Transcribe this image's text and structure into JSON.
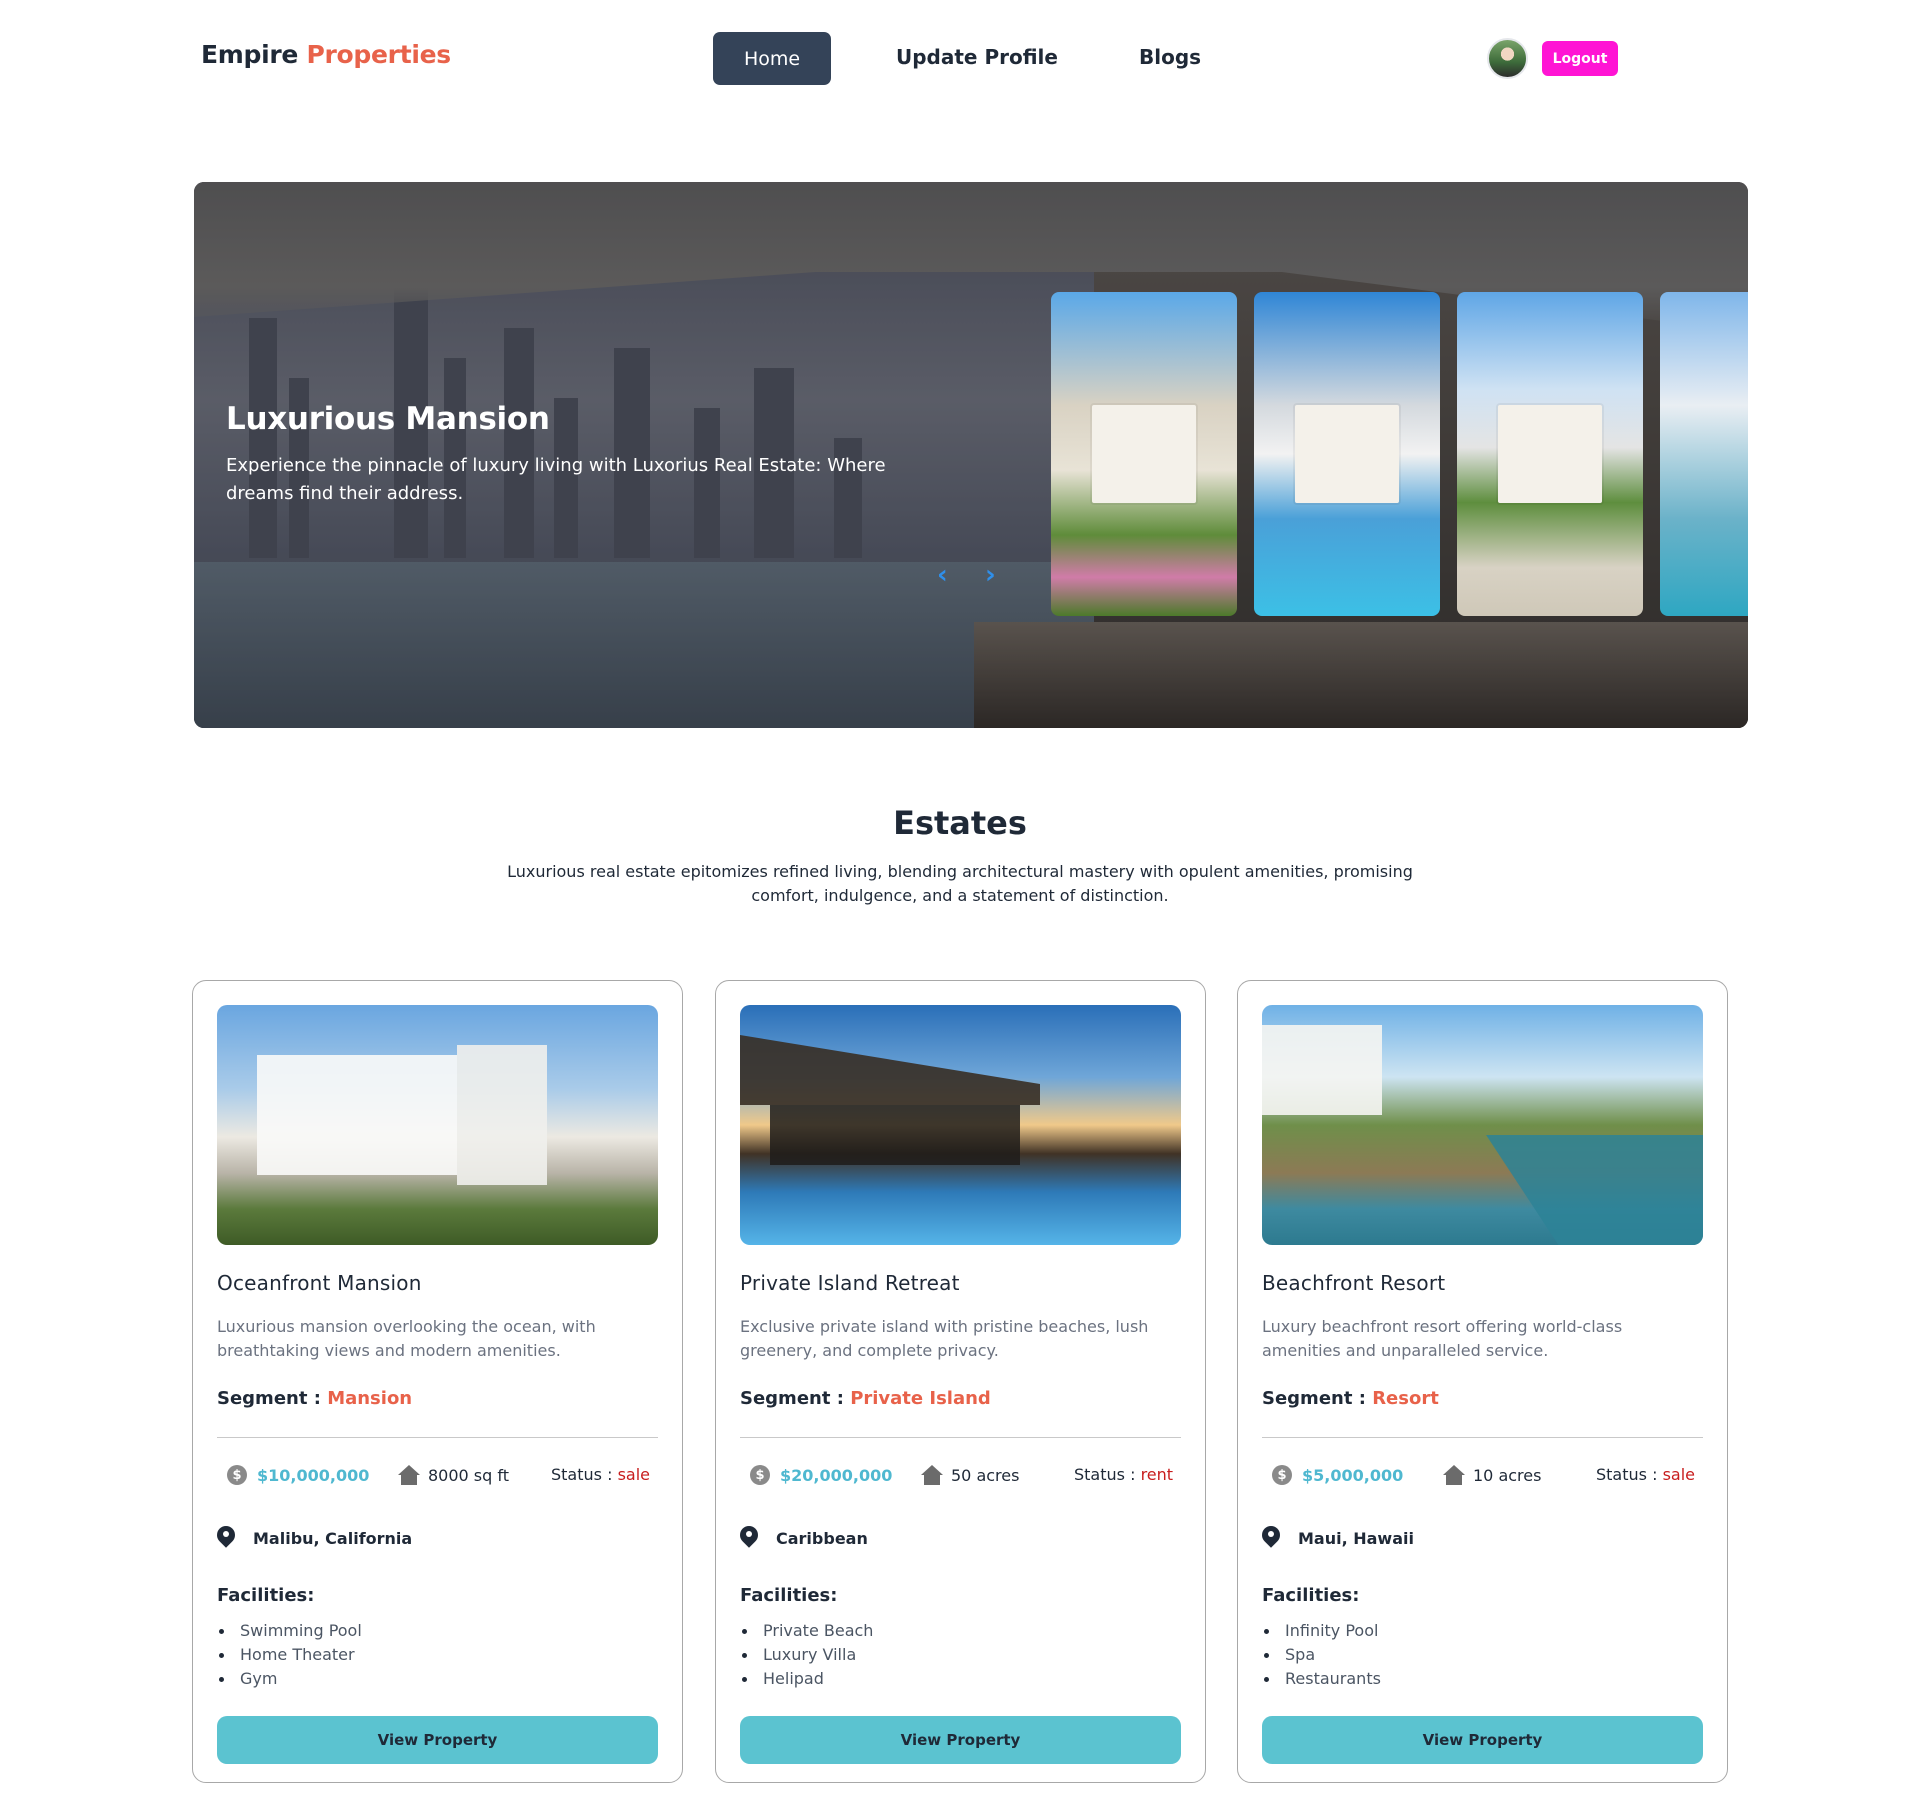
{
  "nav": {
    "brand_main": "Empire",
    "brand_accent": "Properties",
    "home": "Home",
    "update_profile": "Update Profile",
    "blogs": "Blogs",
    "logout": "Logout"
  },
  "hero": {
    "title": "Luxurious Mansion",
    "description": "Experience the pinnacle of luxury living with Luxorius Real Estate: Where dreams find their address.",
    "prev_arrow": "‹",
    "next_arrow": "›"
  },
  "estates": {
    "title": "Estates",
    "description": "Luxurious real estate epitomizes refined living, blending architectural mastery with opulent amenities, promising comfort, indulgence, and a statement of distinction.",
    "segment_label": "Segment :",
    "status_label": "Status :",
    "facilities_label": "Facilities:",
    "button_label": "View Property",
    "cards": [
      {
        "title": "Oceanfront Mansion",
        "description": "Luxurious mansion overlooking the ocean, with breathtaking views and modern amenities.",
        "segment": "Mansion",
        "price": "$10,000,000",
        "area": "8000 sq ft",
        "status": "sale",
        "location": "Malibu, California",
        "facilities": [
          "Swimming Pool",
          "Home Theater",
          "Gym"
        ]
      },
      {
        "title": "Private Island Retreat",
        "description": "Exclusive private island with pristine beaches, lush greenery, and complete privacy.",
        "segment": "Private Island",
        "price": "$20,000,000",
        "area": "50 acres",
        "status": "rent",
        "location": "Caribbean",
        "facilities": [
          "Private Beach",
          "Luxury Villa",
          "Helipad"
        ]
      },
      {
        "title": "Beachfront Resort",
        "description": "Luxury beachfront resort offering world-class amenities and unparalleled service.",
        "segment": "Resort",
        "price": "$5,000,000",
        "area": "10 acres",
        "status": "sale",
        "location": "Maui, Hawaii",
        "facilities": [
          "Infinity Pool",
          "Spa",
          "Restaurants"
        ]
      }
    ]
  },
  "colors": {
    "accent": "#e8624a",
    "nav_active": "#344358",
    "logout": "#ff14d4",
    "price": "#4fb8d0",
    "status": "#c81e1e",
    "button": "#5bc3d0"
  },
  "icons": [
    "dollar-icon",
    "home-icon",
    "location-pin-icon",
    "chevron-left-icon",
    "chevron-right-icon",
    "avatar"
  ]
}
